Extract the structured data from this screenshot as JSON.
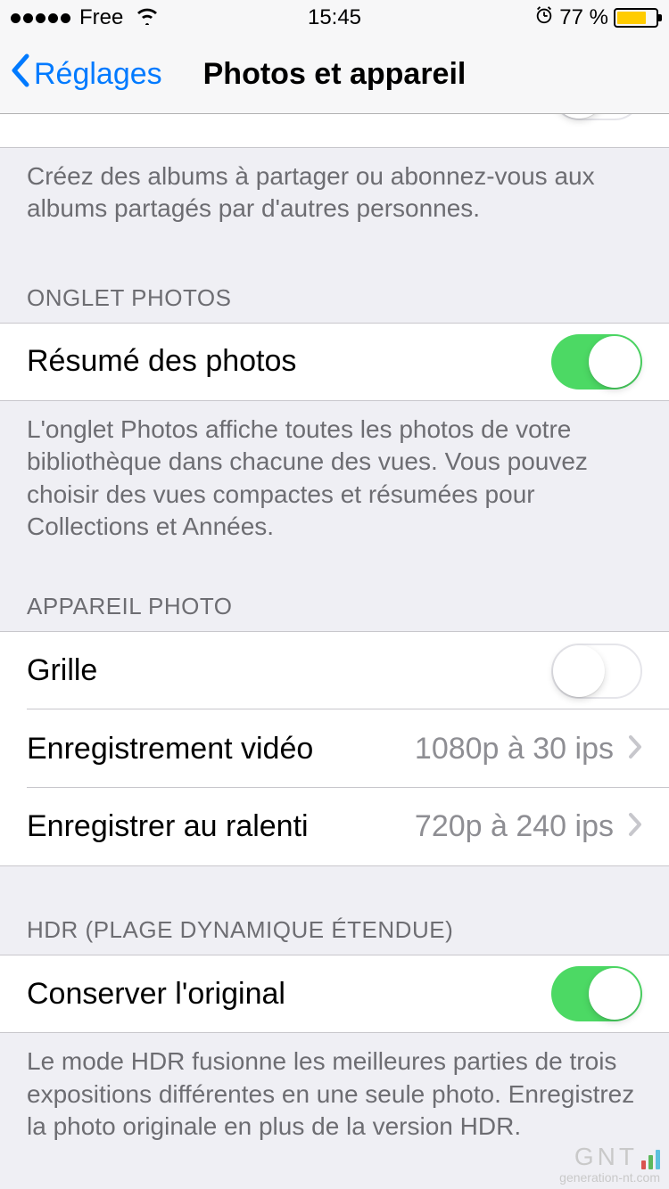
{
  "status": {
    "carrier": "Free",
    "time": "15:45",
    "battery_pct": "77 %"
  },
  "nav": {
    "back_label": "Réglages",
    "title": "Photos et appareil"
  },
  "sections": {
    "top_footer": "Créez des albums à partager ou abonnez-vous aux albums partagés par d'autres personnes.",
    "photos_tab": {
      "header": "ONGLET PHOTOS",
      "summary_label": "Résumé des photos",
      "footer": "L'onglet Photos affiche toutes les photos de votre bibliothèque dans chacune des vues. Vous pouvez choisir des vues compactes et résumées pour Collections et Années."
    },
    "camera": {
      "header": "APPAREIL PHOTO",
      "grid_label": "Grille",
      "video_label": "Enregistrement vidéo",
      "video_value": "1080p à 30 ips",
      "slomo_label": "Enregistrer au ralenti",
      "slomo_value": "720p à 240 ips"
    },
    "hdr": {
      "header": "HDR (PLAGE DYNAMIQUE ÉTENDUE)",
      "keep_label": "Conserver l'original",
      "footer": "Le mode HDR fusionne les meilleures parties de trois expositions différentes en une seule photo. Enregistrez la photo originale en plus de la version HDR."
    }
  },
  "watermark": {
    "brand": "GNT",
    "sub": "generation-nt.com"
  }
}
